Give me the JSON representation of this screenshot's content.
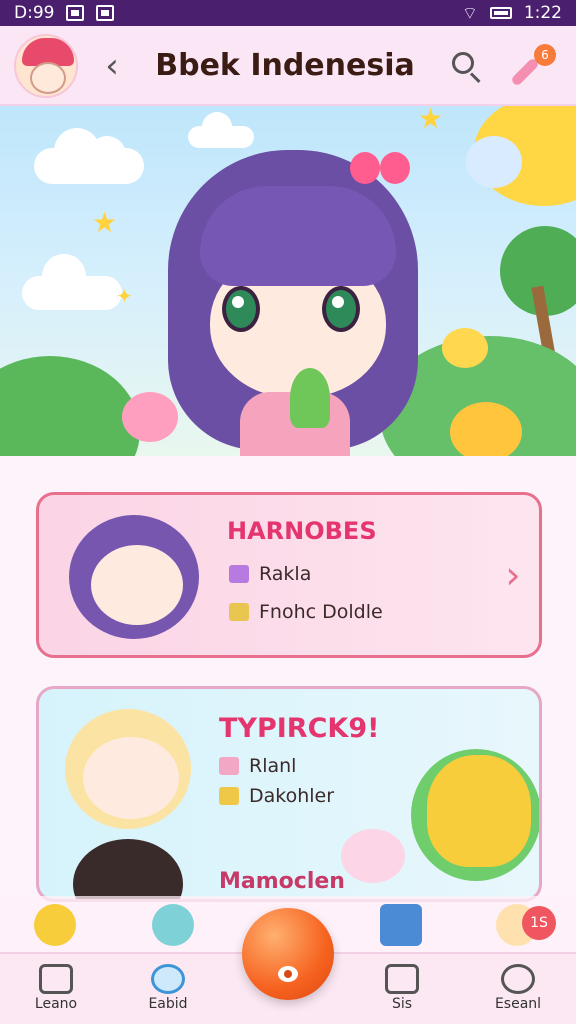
{
  "status_bar": {
    "time_left": "D:99",
    "time_right": "1:22"
  },
  "header": {
    "title": "Bbek Indenesia",
    "back_glyph": "‹",
    "notification_count": "6"
  },
  "hero": {
    "stars": [
      "★",
      "★",
      "✦"
    ]
  },
  "cards": [
    {
      "title": "HARNOBES",
      "lines": [
        "Rakla",
        "Fnohc Doldle"
      ],
      "chevron": "›"
    },
    {
      "title": "TYPIRCK9!",
      "lines": [
        "Rlanl",
        "Dakohler"
      ],
      "footer": "Mamoclen"
    }
  ],
  "nav_strip": {
    "badge": "1S"
  },
  "bottom_nav": {
    "home_label": "Leano",
    "chat_label": "Eabid",
    "files_label": "Sis",
    "settings_label": "Eseanl"
  },
  "icons": {
    "avatar": "avatar-icon",
    "search": "search-icon",
    "brush": "brush-icon",
    "home": "home-icon",
    "chat": "chat-bubble-icon",
    "files": "tablet-icon",
    "settings": "settings-icon"
  },
  "colors": {
    "accent": "#e4356f",
    "status_bar": "#4a1f6e",
    "fab": "#f6621f"
  }
}
